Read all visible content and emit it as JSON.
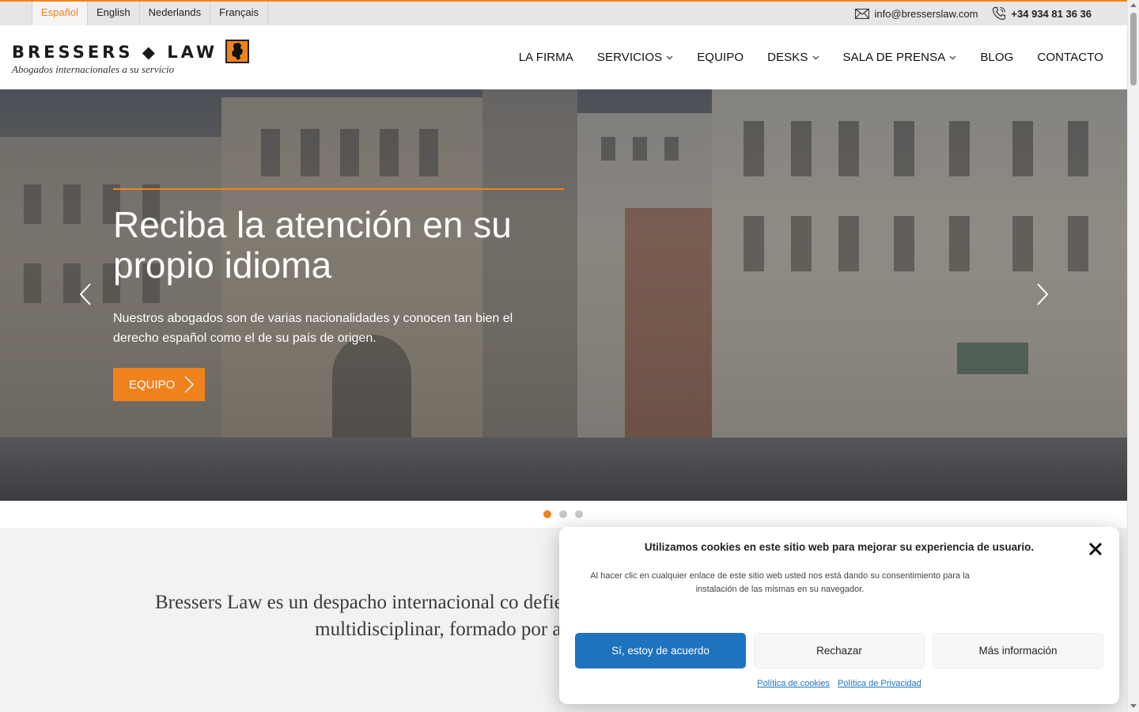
{
  "topbar": {
    "languages": [
      "Español",
      "English",
      "Nederlands",
      "Français"
    ],
    "email": "info@bresserslaw.com",
    "phone": "+34 934 81 36 36"
  },
  "header": {
    "logo_text": "BRESSERS ◆ LAW",
    "logo_tagline": "Abogados internacionales a su servicio",
    "nav": [
      "LA FIRMA",
      "SERVICIOS",
      "EQUIPO",
      "DESKS",
      "SALA DE PRENSA",
      "BLOG",
      "CONTACTO"
    ]
  },
  "hero": {
    "title": "Reciba la atención en su propio idioma",
    "text": "Nuestros abogados son de varias nacionalidades y conocen tan bien el derecho español como el de su país de origen.",
    "button": "EQUIPO",
    "slide_count": 3,
    "active_slide": 1
  },
  "intro": {
    "text": "Bressers Law es un despacho internacional co defiende los intereses de clientes tanto naciona equipo multidisciplinar, formado por abogados y reconocida trayect"
  },
  "cookie": {
    "title": "Utilizamos cookies en este sitio web para mejorar su experiencia de usuario.",
    "message": "Al hacer clic en cualquier enlace de este sitio web usted nos está dando su consentimiento para la instalación de las mismas en su navegador.",
    "accept": "Sí, estoy de acuerdo",
    "deny": "Rechazar",
    "more": "Más información",
    "link_cookies": "Política de cookies",
    "link_privacy": "Política de Privacidad"
  },
  "colors": {
    "accent": "#f0821e",
    "primary_blue": "#1e73be"
  }
}
